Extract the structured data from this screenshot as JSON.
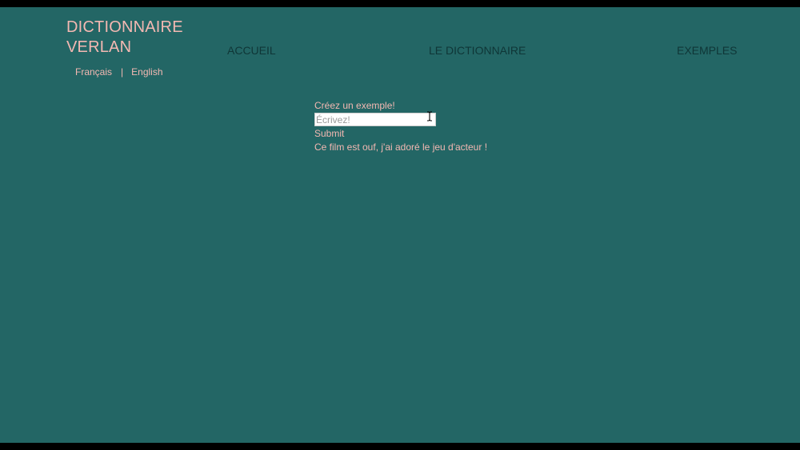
{
  "header": {
    "logo": "DICTIONNAIRE VERLAN",
    "languages": [
      "Français",
      "English"
    ],
    "separator": "|"
  },
  "nav": {
    "items": [
      {
        "label": "ACCUEIL"
      },
      {
        "label": "LE DICTIONNAIRE"
      },
      {
        "label": "EXEMPLES"
      }
    ]
  },
  "form": {
    "label": "Créez un exemple!",
    "input_value": "",
    "input_placeholder": "Écrivez!",
    "submit_label": "Submit"
  },
  "example": {
    "text": "Ce film est ouf, j'ai adoré le jeu d'acteur !"
  },
  "colors": {
    "background": "#236665",
    "accent_pink": "#f3b8b2",
    "nav_dark": "#0f3637"
  },
  "cursor": {
    "icon": "text-cursor-icon"
  }
}
